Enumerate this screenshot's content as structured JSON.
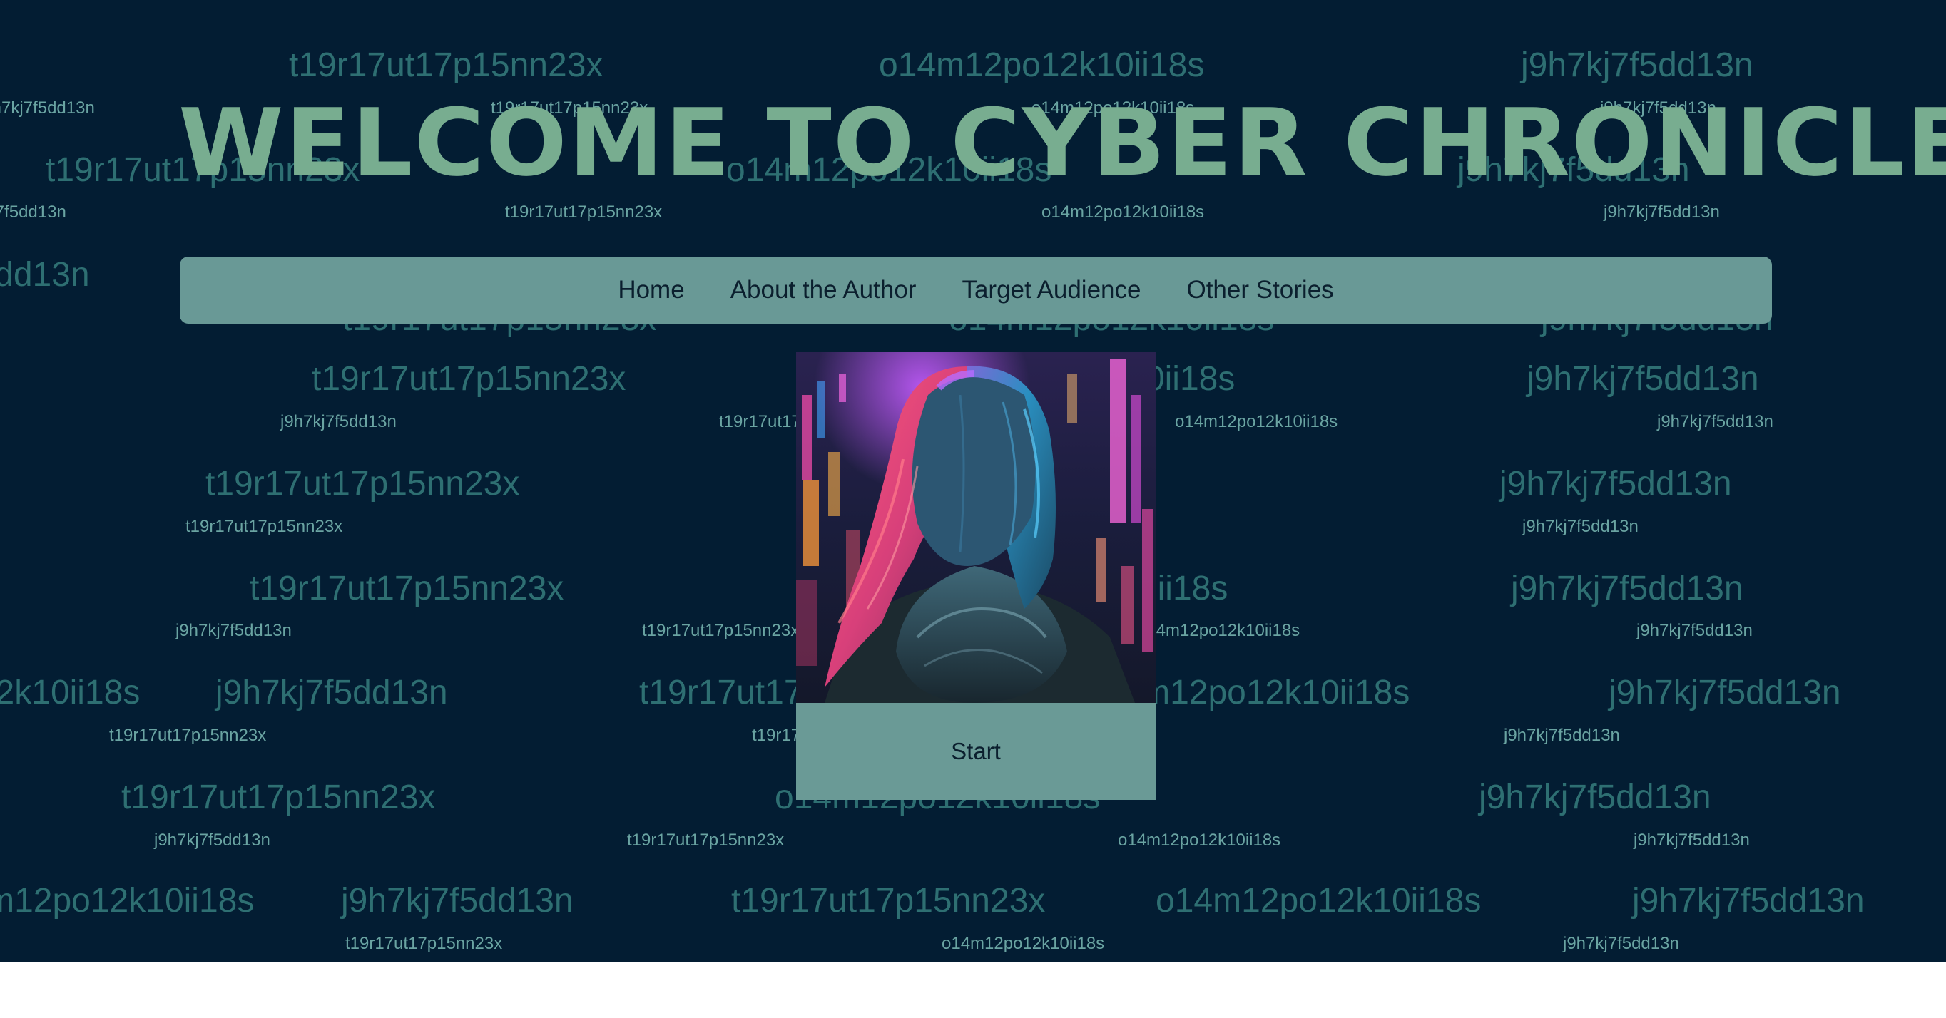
{
  "title": "WELCOME TO CYBER CHRONICLES!",
  "nav": {
    "items": [
      "Home",
      "About the Author",
      "Target Audience",
      "Other Stories"
    ]
  },
  "start_button": {
    "label": "Start"
  },
  "background_words": [
    "t19r17ut17p15nn23x",
    "o14m12po12k10ii18s",
    "j9h7kj7f5dd13n"
  ],
  "colors": {
    "background": "#031d33",
    "title": "#78ad90",
    "nav": "#699996",
    "pattern_text": "#2e6f72"
  }
}
